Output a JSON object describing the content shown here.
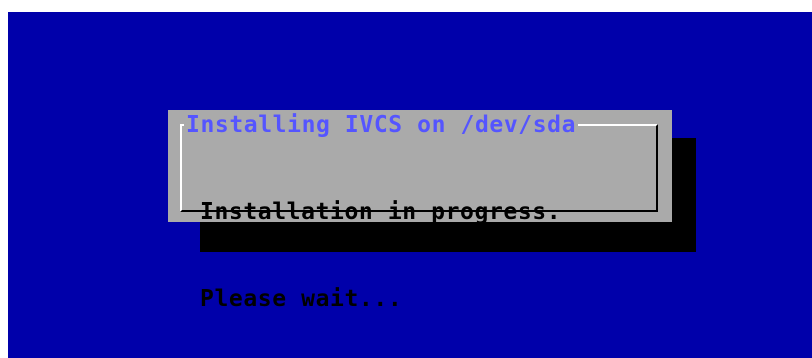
{
  "dialog": {
    "title": "Installing IVCS on /dev/sda",
    "message_lines": [
      "Installation in progress.",
      "Please wait..."
    ]
  },
  "colors": {
    "background": "#0000aa",
    "dialog_background": "#aaaaaa",
    "title_text": "#5555ff",
    "body_text": "#000000",
    "shadow": "#000000"
  }
}
